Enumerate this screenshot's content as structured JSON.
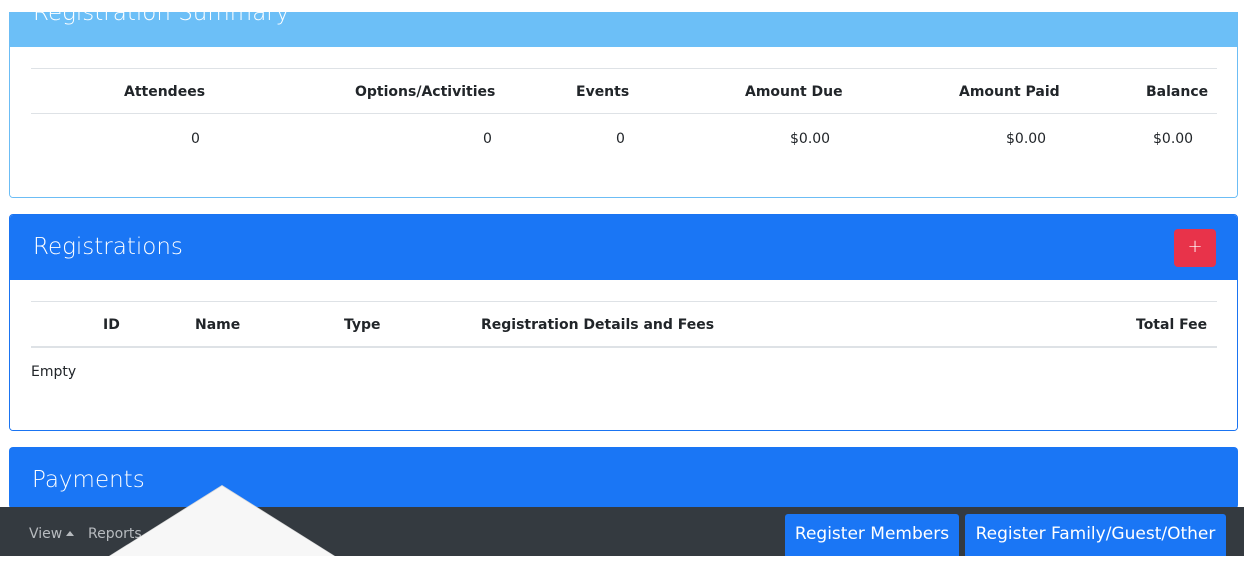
{
  "summary": {
    "title": "Registration Summary",
    "headers": [
      "Attendees",
      "Options/Activities",
      "Events",
      "Amount Due",
      "Amount Paid",
      "Balance"
    ],
    "row": [
      "0",
      "0",
      "0",
      "$0.00",
      "$0.00",
      "$0.00"
    ]
  },
  "registrations": {
    "title": "Registrations",
    "add_label": "+",
    "headers": [
      "ID",
      "Name",
      "Type",
      "Registration Details and Fees",
      "Total Fee"
    ],
    "empty_text": "Empty"
  },
  "payments": {
    "title": "Payments"
  },
  "bottom_bar": {
    "view_label": "View",
    "reports_label": "Reports",
    "register_members_label": "Register Members",
    "register_family_label": "Register Family/Guest/Other"
  },
  "colors": {
    "summary_header": "#6cbff7",
    "primary": "#1a76f5",
    "danger": "#e8334a",
    "bottom_bar": "#343a40"
  }
}
